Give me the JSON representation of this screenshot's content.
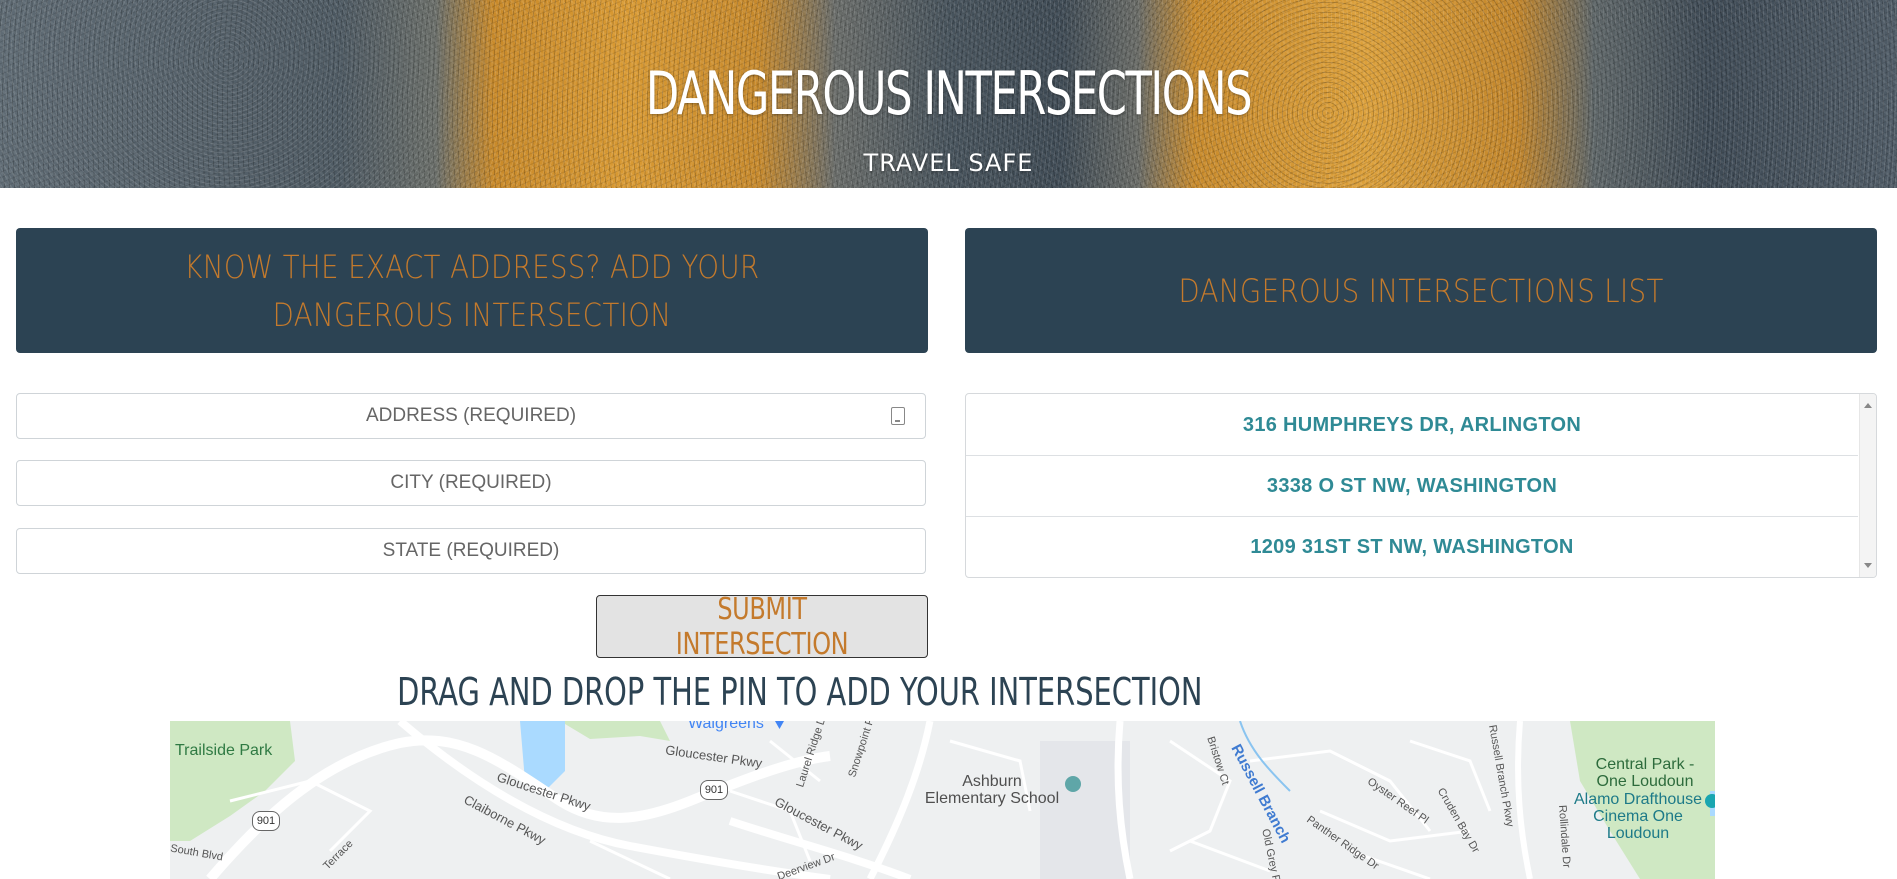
{
  "hero": {
    "title": "DANGEROUS INTERSECTIONS",
    "subtitle": "TRAVEL SAFE"
  },
  "add_panel": {
    "heading": "KNOW THE EXACT ADDRESS? ADD YOUR DANGEROUS INTERSECTION",
    "address_placeholder": "ADDRESS (REQUIRED)",
    "city_placeholder": "CITY (REQUIRED)",
    "state_placeholder": "STATE (REQUIRED)",
    "address_value": "",
    "city_value": "",
    "state_value": "",
    "submit_label": "SUBMIT INTERSECTION"
  },
  "list_panel": {
    "heading": "DANGEROUS INTERSECTIONS LIST",
    "items": [
      "316 HUMPHREYS DR, ARLINGTON",
      "3338 O ST NW, WASHINGTON",
      "1209 31ST ST NW, WASHINGTON"
    ]
  },
  "map_section": {
    "title": "DRAG AND DROP THE PIN TO ADD YOUR INTERSECTION",
    "labels": {
      "trailside_park": "Trailside Park",
      "walgreens": "Walgreens",
      "gloucester_pkwy_1": "Gloucester Pkwy",
      "gloucester_pkwy_2": "Gloucester Pkwy",
      "gloucester_pkwy_3": "Gloucester Pkwy",
      "claiborne_pkwy": "Claiborne Pkwy",
      "ashburn_school": "Ashburn\nElementary School",
      "russell_branch": "Russell Branch",
      "central_park": "Central Park -\nOne Loudoun",
      "alamo": "Alamo Drafthouse\nCinema One Loudoun",
      "laurel_ridge": "Laurel Ridge Dr",
      "snowpoint": "Snowpoint Pl",
      "oyster_reef": "Oyster Reef Pl",
      "panther_ridge": "Panther Ridge Dr",
      "old_grey": "Old Grey Pl",
      "cruden_bay": "Cruden Bay Dr",
      "russell_branch_pkwy": "Russell Branch Pkwy",
      "rollindale": "Rollindale Dr",
      "bristow": "Bristow Ct",
      "deerview": "Deerview Dr",
      "south_blvd": "South Blvd",
      "terrace": "Terrace",
      "route_901_a": "901",
      "route_901_b": "901"
    }
  }
}
